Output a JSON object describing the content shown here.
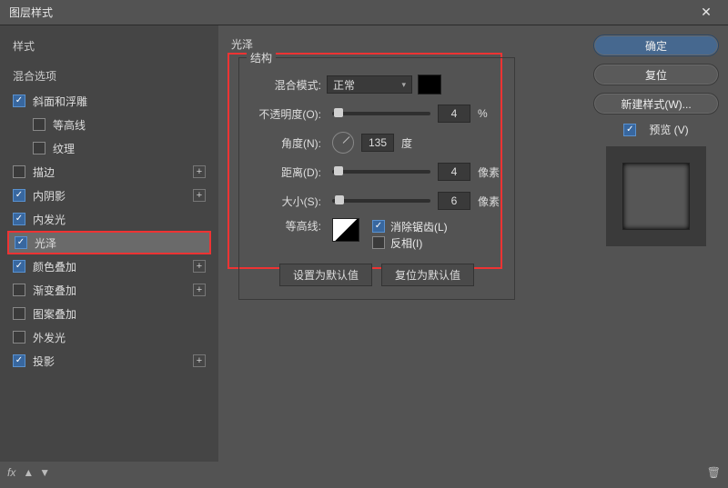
{
  "window": {
    "title": "图层样式"
  },
  "sidebar": {
    "header": "样式",
    "blend_header": "混合选项",
    "items": [
      {
        "label": "斜面和浮雕",
        "checked": true,
        "plus": false,
        "indent": false
      },
      {
        "label": "等高线",
        "checked": false,
        "plus": false,
        "indent": true
      },
      {
        "label": "纹理",
        "checked": false,
        "plus": false,
        "indent": true
      },
      {
        "label": "描边",
        "checked": false,
        "plus": true,
        "indent": false
      },
      {
        "label": "内阴影",
        "checked": true,
        "plus": true,
        "indent": false
      },
      {
        "label": "内发光",
        "checked": true,
        "plus": false,
        "indent": false
      },
      {
        "label": "光泽",
        "checked": true,
        "plus": false,
        "indent": false,
        "selected": true
      },
      {
        "label": "颜色叠加",
        "checked": true,
        "plus": true,
        "indent": false
      },
      {
        "label": "渐变叠加",
        "checked": false,
        "plus": true,
        "indent": false
      },
      {
        "label": "图案叠加",
        "checked": false,
        "plus": false,
        "indent": false
      },
      {
        "label": "外发光",
        "checked": false,
        "plus": false,
        "indent": false
      },
      {
        "label": "投影",
        "checked": true,
        "plus": true,
        "indent": false
      }
    ]
  },
  "main": {
    "title": "光泽",
    "fieldset_label": "结构",
    "blend_mode_label": "混合模式:",
    "blend_mode_value": "正常",
    "opacity_label": "不透明度(O):",
    "opacity_value": "4",
    "opacity_unit": "%",
    "angle_label": "角度(N):",
    "angle_value": "135",
    "angle_unit": "度",
    "distance_label": "距离(D):",
    "distance_value": "4",
    "distance_unit": "像素",
    "size_label": "大小(S):",
    "size_value": "6",
    "size_unit": "像素",
    "contour_label": "等高线:",
    "antialias_label": "消除锯齿(L)",
    "antialias_checked": true,
    "invert_label": "反相(I)",
    "invert_checked": false,
    "reset_default": "设置为默认值",
    "revert_default": "复位为默认值"
  },
  "right": {
    "ok": "确定",
    "cancel": "复位",
    "new_style": "新建样式(W)...",
    "preview_label": "预览 (V)",
    "preview_checked": true
  },
  "footer": {
    "fx": "fx"
  }
}
